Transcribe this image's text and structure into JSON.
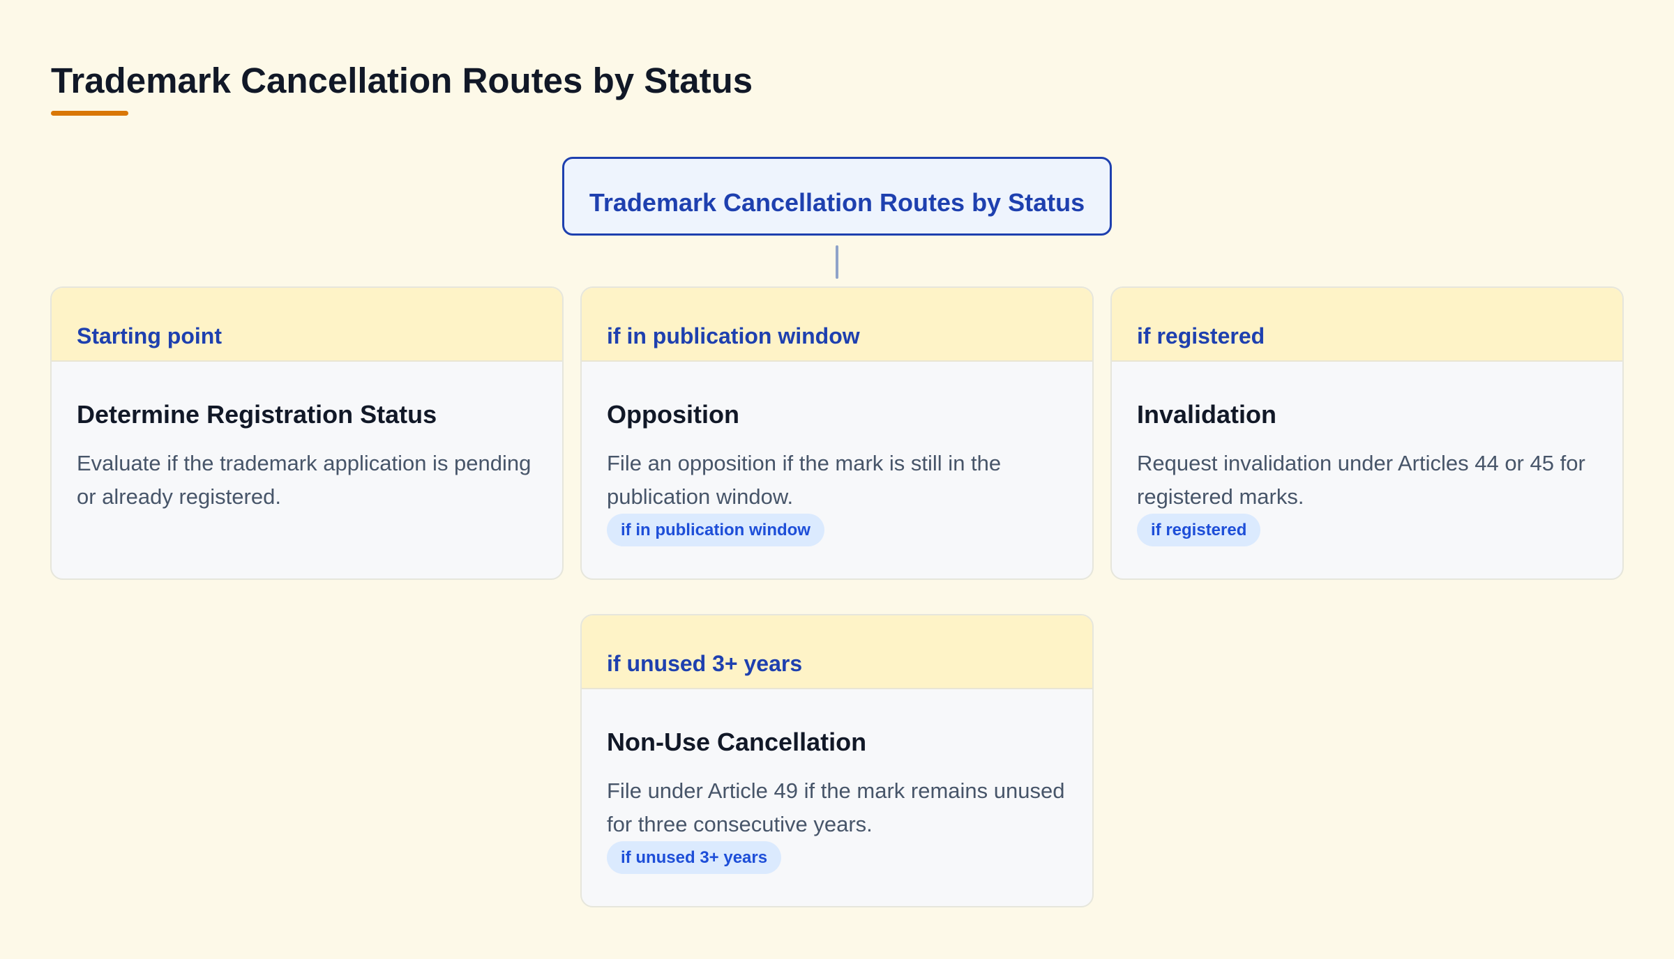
{
  "page_title": "Trademark Cancellation Routes by Status",
  "colors": {
    "background": "#fdf9e8",
    "accent": "#d97706",
    "primary_blue": "#1e40af",
    "card_header": "#fef3c7",
    "badge_bg": "#dbeafe"
  },
  "root": {
    "label": "Trademark Cancellation Routes by Status"
  },
  "cards": [
    {
      "header": "Starting point",
      "title": "Determine Registration Status",
      "description": "Evaluate if the trademark application is pending or already registered.",
      "badge": null
    },
    {
      "header": "if in publication window",
      "title": "Opposition",
      "description": "File an opposition if the mark is still in the publication window.",
      "badge": "if in publication window"
    },
    {
      "header": "if registered",
      "title": "Invalidation",
      "description": "Request invalidation under Articles 44 or 45 for registered marks.",
      "badge": "if registered"
    },
    {
      "header": "if unused 3+ years",
      "title": "Non-Use Cancellation",
      "description": "File under Article 49 if the mark remains unused for three consecutive years.",
      "badge": "if unused 3+ years"
    }
  ]
}
